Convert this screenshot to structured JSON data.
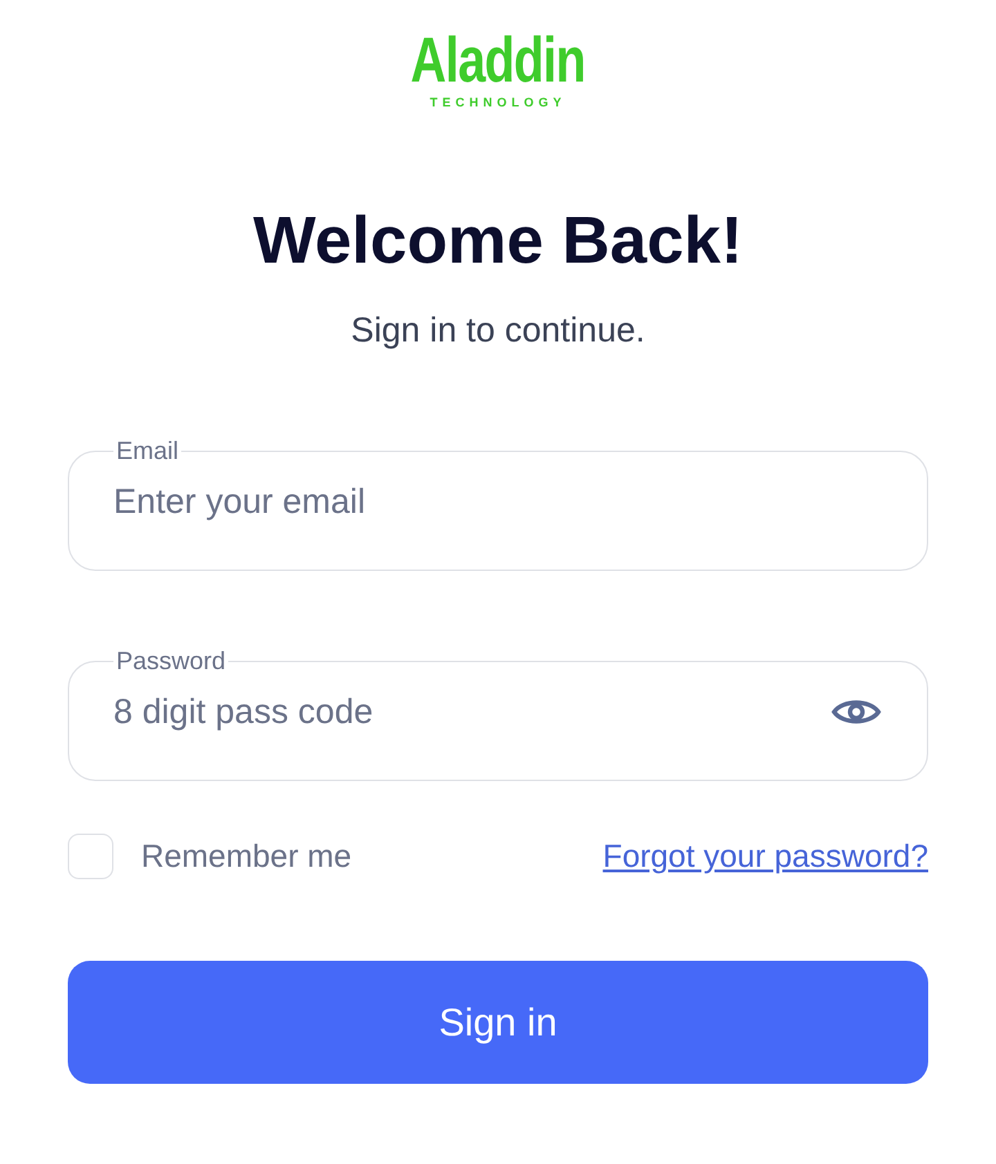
{
  "logo": {
    "name": "Aladdin",
    "tagline": "TECHNOLOGY"
  },
  "heading": "Welcome Back!",
  "subheading": "Sign in to continue.",
  "fields": [
    {
      "kind": "email",
      "label": "Email",
      "placeholder": "Enter your email"
    },
    {
      "kind": "password",
      "label": "Password",
      "placeholder": "8 digit pass code"
    }
  ],
  "remember": {
    "label": "Remember me",
    "checked": false
  },
  "forgot_link": "Forgot your password?",
  "submit": "Sign in"
}
